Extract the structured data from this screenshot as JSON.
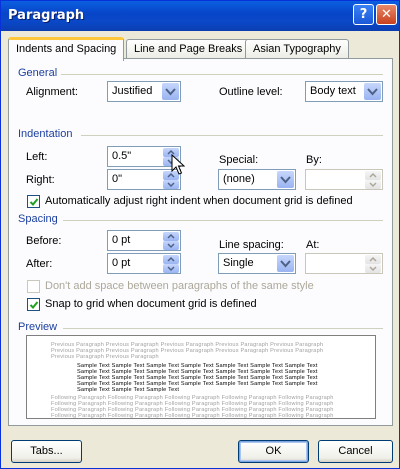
{
  "window": {
    "title": "Paragraph",
    "help_glyph": "?",
    "close_glyph": "✕"
  },
  "tabs": [
    {
      "label": "Indents and Spacing",
      "active": true
    },
    {
      "label": "Line and Page Breaks",
      "active": false
    },
    {
      "label": "Asian Typography",
      "active": false
    }
  ],
  "general": {
    "heading": "General",
    "alignment_label": "Alignment:",
    "alignment_value": "Justified",
    "outline_label": "Outline level:",
    "outline_value": "Body text"
  },
  "indentation": {
    "heading": "Indentation",
    "left_label": "Left:",
    "left_value": "0.5\"",
    "right_label": "Right:",
    "right_value": "0\"",
    "special_label": "Special:",
    "special_value": "(none)",
    "by_label": "By:",
    "by_value": "",
    "auto_adjust_label": "Automatically adjust right indent when document grid is defined",
    "auto_adjust_checked": true
  },
  "spacing": {
    "heading": "Spacing",
    "before_label": "Before:",
    "before_value": "0 pt",
    "after_label": "After:",
    "after_value": "0 pt",
    "line_spacing_label": "Line spacing:",
    "line_spacing_value": "Single",
    "at_label": "At:",
    "at_value": "",
    "no_space_label": "Don't add space between paragraphs of the same style",
    "no_space_checked": false,
    "snap_label": "Snap to grid when document grid is defined",
    "snap_checked": true
  },
  "preview": {
    "heading": "Preview",
    "previous_lines": [
      "Previous Paragraph Previous Paragraph Previous Paragraph Previous Paragraph Previous Paragraph",
      "Previous Paragraph Previous Paragraph Previous Paragraph Previous Paragraph Previous Paragraph",
      "Previous Paragraph Previous Paragraph"
    ],
    "sample_lines": [
      "Sample Text Sample Text Sample Text Sample Text Sample Text Sample Text Sample Text",
      "Sample Text Sample Text Sample Text Sample Text Sample Text Sample Text Sample Text",
      "Sample Text Sample Text Sample Text Sample Text Sample Text Sample Text Sample Text",
      "Sample Text Sample Text Sample Text Sample Text Sample Text Sample Text Sample Text",
      "Sample Text Sample Text Sample Text"
    ],
    "following_lines": [
      "Following Paragraph Following Paragraph Following Paragraph Following Paragraph Following Paragraph",
      "Following Paragraph Following Paragraph Following Paragraph Following Paragraph Following Paragraph",
      "Following Paragraph Following Paragraph Following Paragraph Following Paragraph Following Paragraph",
      "Following Paragraph Following Paragraph Following Paragraph Following Paragraph Following Paragraph"
    ]
  },
  "buttons": {
    "tabs": "Tabs...",
    "ok": "OK",
    "cancel": "Cancel"
  },
  "colors": {
    "title_bar": "#0a5fe0",
    "section_heading": "#1c3fa0",
    "dialog_bg": "#ece9d8",
    "tab_highlight": "#ffc83c"
  }
}
